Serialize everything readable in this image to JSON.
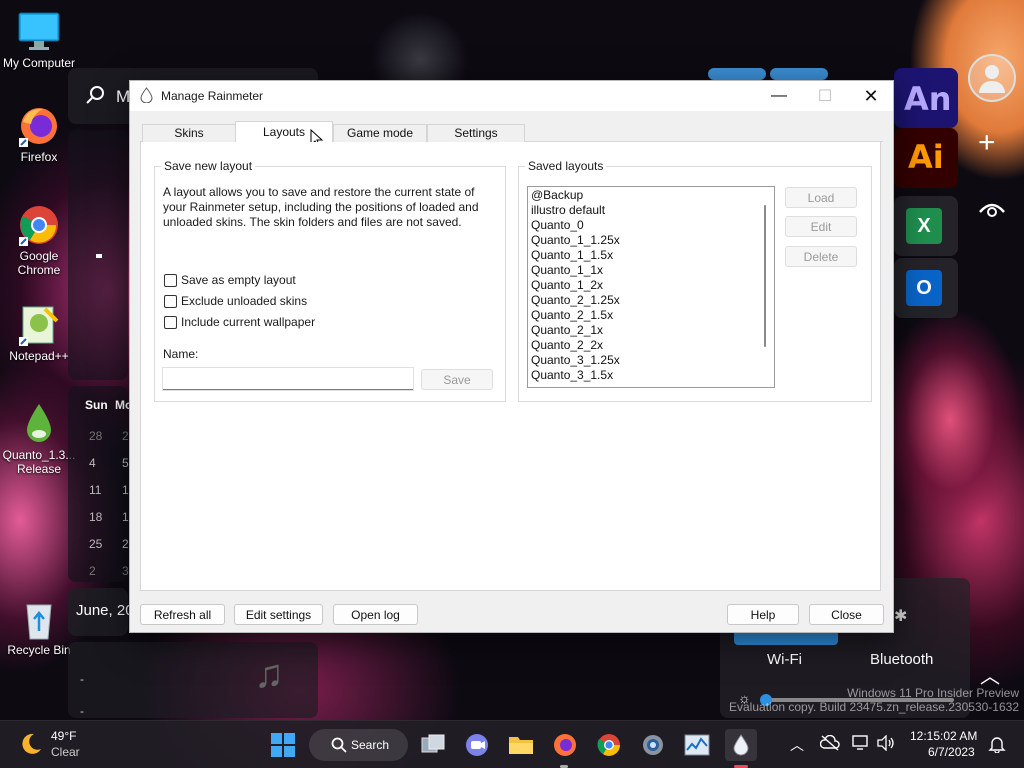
{
  "desktop": {
    "icons": [
      {
        "label": "My Computer"
      },
      {
        "label": "Firefox"
      },
      {
        "label": "Google Chrome"
      },
      {
        "label": "Notepad++"
      },
      {
        "label": "Quanto_1.3... Release"
      },
      {
        "label": "Recycle Bin"
      }
    ],
    "widget": {
      "search_letter": "M",
      "calendar_days": [
        "Sun",
        "Mo"
      ],
      "calendar_rows": [
        "28",
        "4",
        "11",
        "18",
        "25",
        "2"
      ],
      "calendar_col2": [
        "2",
        "5",
        "1",
        "1",
        "2",
        "3"
      ],
      "date_text": "June, 20",
      "quick": {
        "wifi_label": "Wi-Fi",
        "bluetooth_label": "Bluetooth"
      },
      "watermark_line1": "Windows 11 Pro Insider Preview",
      "watermark_line2": "Evaluation copy. Build 23475.zn_release.230530-1632"
    },
    "tiles": {
      "an": "An",
      "ai": "Ai",
      "excel": "X",
      "outlook": "O"
    }
  },
  "window": {
    "title": "Manage Rainmeter",
    "tabs": [
      {
        "label": "Skins"
      },
      {
        "label": "Layouts"
      },
      {
        "label": "Game mode"
      },
      {
        "label": "Settings"
      }
    ],
    "save_layout": {
      "group_label": "Save new layout",
      "description": "A layout allows you to save and restore the current state of your Rainmeter setup, including the positions of loaded and unloaded skins. The skin folders and files are not saved.",
      "options": [
        {
          "label": "Save as empty layout",
          "checked": false
        },
        {
          "label": "Exclude unloaded skins",
          "checked": false
        },
        {
          "label": "Include current wallpaper",
          "checked": false
        }
      ],
      "name_label": "Name:",
      "name_value": "",
      "save_button": "Save"
    },
    "saved_layouts": {
      "group_label": "Saved layouts",
      "items": [
        "@Backup",
        "illustro default",
        "Quanto_0",
        "Quanto_1_1.25x",
        "Quanto_1_1.5x",
        "Quanto_1_1x",
        "Quanto_1_2x",
        "Quanto_2_1.25x",
        "Quanto_2_1.5x",
        "Quanto_2_1x",
        "Quanto_2_2x",
        "Quanto_3_1.25x",
        "Quanto_3_1.5x"
      ],
      "load_button": "Load",
      "edit_button": "Edit",
      "delete_button": "Delete"
    },
    "footer": {
      "refresh": "Refresh all",
      "edit_settings": "Edit settings",
      "open_log": "Open log",
      "help": "Help",
      "close": "Close"
    }
  },
  "taskbar": {
    "weather_temp": "49°F",
    "weather_desc": "Clear",
    "search_label": "Search",
    "time": "12:15:02 AM",
    "date": "6/7/2023"
  }
}
